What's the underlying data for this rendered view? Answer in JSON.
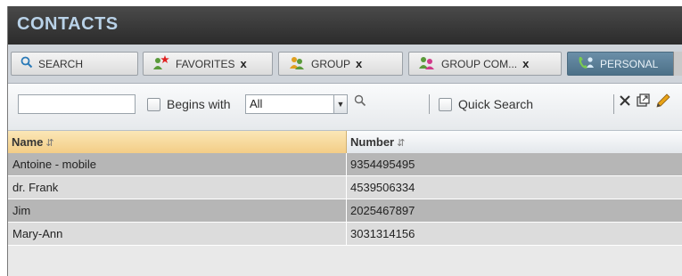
{
  "title": "CONTACTS",
  "tabs": [
    {
      "label": "SEARCH",
      "icon": "magnifier-icon",
      "close": ""
    },
    {
      "label": "FAVORITES",
      "icon": "favorites-people-icon",
      "close": "x"
    },
    {
      "label": "GROUP",
      "icon": "group-people-icon",
      "close": "x"
    },
    {
      "label": "GROUP COM...",
      "icon": "group-common-icon",
      "close": "x"
    },
    {
      "label": "PERSONAL",
      "icon": "personal-phone-icon",
      "close": ""
    }
  ],
  "toolbar": {
    "search_value": "",
    "begins_with_label": "Begins with",
    "filter_value": "All",
    "quick_search_label": "Quick Search"
  },
  "table": {
    "columns": [
      "Name",
      "Number"
    ],
    "rows": [
      {
        "name": "Antoine - mobile",
        "number": "9354495495"
      },
      {
        "name": "dr. Frank",
        "number": "4539506334"
      },
      {
        "name": "Jim",
        "number": "2025467897"
      },
      {
        "name": "Mary-Ann",
        "number": "3031314156"
      }
    ]
  },
  "colors": {
    "title_bar": "#2b2b2b",
    "title_text": "#b9d2e8",
    "active_tab": "#5a7e96",
    "name_header": "#f3cd86",
    "row_dark": "#b6b6b6",
    "row_light": "#dcdcdc",
    "edit_icon": "#e8a317"
  }
}
